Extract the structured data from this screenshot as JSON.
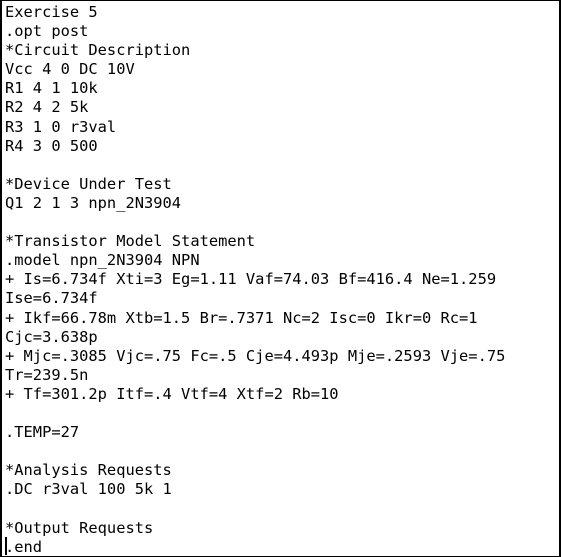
{
  "editor": {
    "lines": [
      "Exercise 5",
      ".opt post",
      "*Circuit Description",
      "Vcc 4 0 DC 10V",
      "R1 4 1 10k",
      "R2 4 2 5k",
      "R3 1 0 r3val",
      "R4 3 0 500",
      "",
      "*Device Under Test",
      "Q1 2 1 3 npn_2N3904",
      "",
      "*Transistor Model Statement",
      ".model npn_2N3904 NPN",
      "+ Is=6.734f Xti=3 Eg=1.11 Vaf=74.03 Bf=416.4 Ne=1.259",
      "Ise=6.734f",
      "+ Ikf=66.78m Xtb=1.5 Br=.7371 Nc=2 Isc=0 Ikr=0 Rc=1",
      "Cjc=3.638p",
      "+ Mjc=.3085 Vjc=.75 Fc=.5 Cje=4.493p Mje=.2593 Vje=.75",
      "Tr=239.5n",
      "+ Tf=301.2p Itf=.4 Vtf=4 Xtf=2 Rb=10",
      "",
      ".TEMP=27",
      "",
      "*Analysis Requests",
      ".DC r3val 100 5k 1",
      "",
      "*Output Requests",
      ".end"
    ]
  }
}
